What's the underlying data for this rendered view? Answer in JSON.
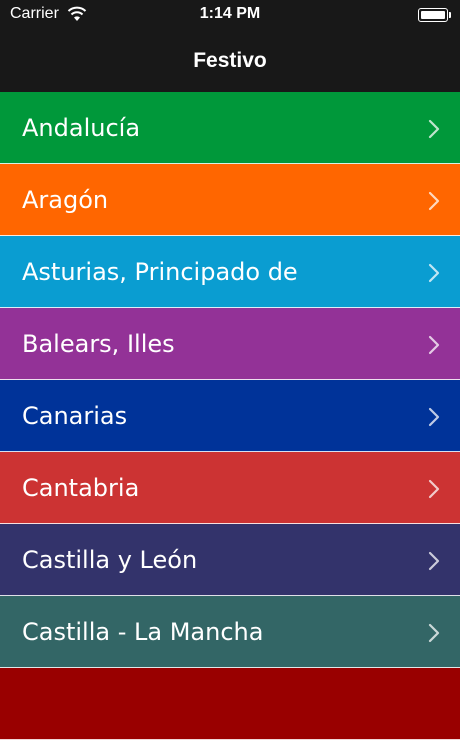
{
  "status": {
    "carrier": "Carrier",
    "time": "1:14 PM"
  },
  "nav": {
    "title": "Festivo"
  },
  "regions": [
    {
      "label": "Andalucía",
      "color": "#00983a"
    },
    {
      "label": "Aragón",
      "color": "#ff6600"
    },
    {
      "label": "Asturias, Principado de",
      "color": "#0a9dd1"
    },
    {
      "label": "Balears, Illes",
      "color": "#933297"
    },
    {
      "label": "Canarias",
      "color": "#003399"
    },
    {
      "label": "Cantabria",
      "color": "#cc3333"
    },
    {
      "label": "Castilla y León",
      "color": "#33336b"
    },
    {
      "label": "Castilla - La Mancha",
      "color": "#336666"
    },
    {
      "label": "",
      "color": "#990000"
    }
  ]
}
